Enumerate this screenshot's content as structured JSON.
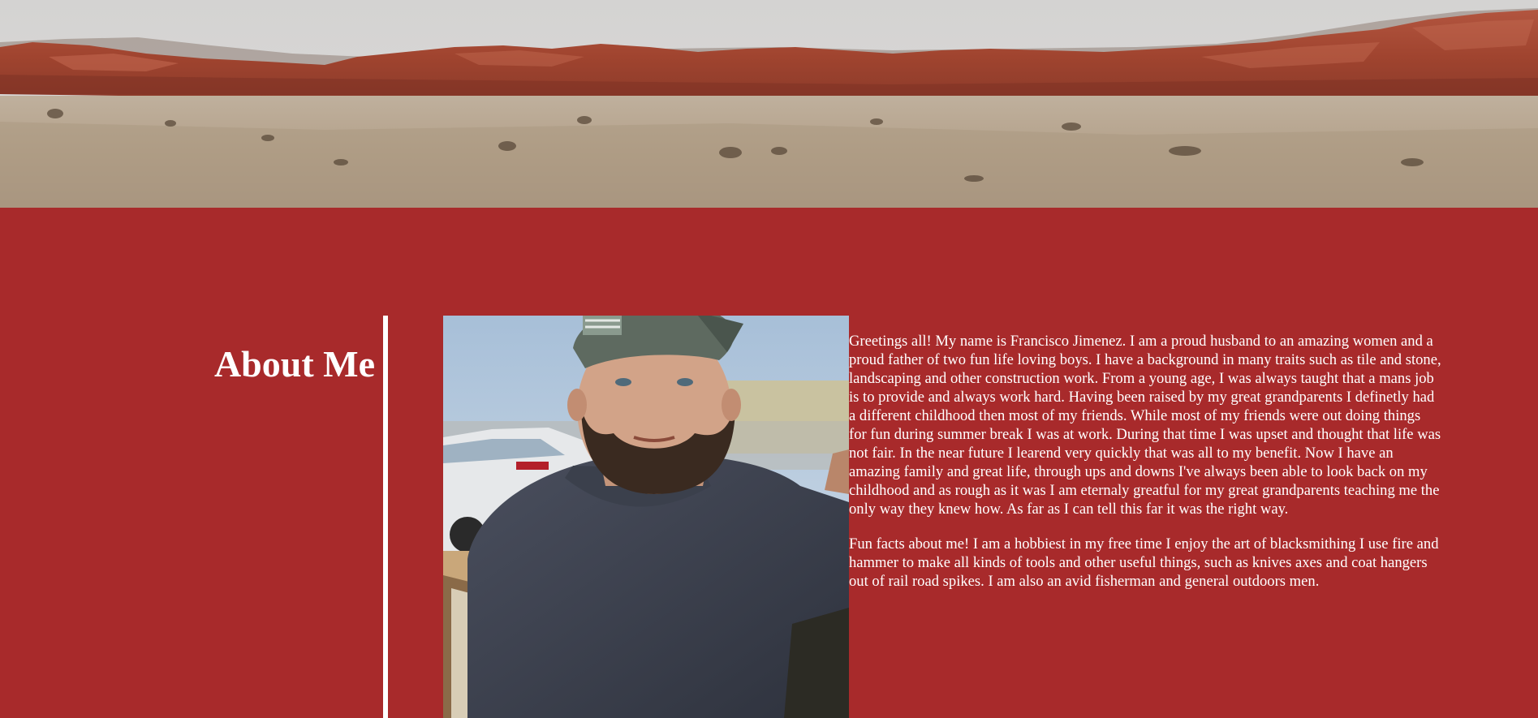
{
  "about": {
    "heading": "About Me",
    "paragraphs": [
      "Greetings all! My name is Francisco Jimenez. I am a proud husband to an amazing women and a proud father of two fun life loving boys. I have a background in many traits such as tile and stone, landscaping and other construction work. From a young age, I was always taught that a mans job is to provide and always work hard. Having been raised by my great grandparents I definetly had a different childhood then most of my friends. While most of my friends were out doing things for fun during summer break I was at work. During that time I was upset and thought that life was not fair. In the near future I learend very quickly that was all to my benefit. Now I have an amazing family and great life, through ups and downs I've always been able to look back on my childhood and as rough as it was I am eternaly greatful for my great grandparents teaching me the only way they knew how. As far as I can tell this far it was the right way.",
      "Fun facts about me! I am a hobbiest in my free time I enjoy the art of blacksmithing I use fire and hammer to make all kinds of tools and other useful things, such as knives axes and coat hangers out of rail road spikes. I am also an avid fisherman and general outdoors men."
    ]
  },
  "colors": {
    "background": "#a82a2b",
    "text": "#ffffff",
    "divider": "#ffffff"
  },
  "images": {
    "hero": "desert-red-rock-landscape",
    "portrait": "portrait-man-in-cap"
  }
}
